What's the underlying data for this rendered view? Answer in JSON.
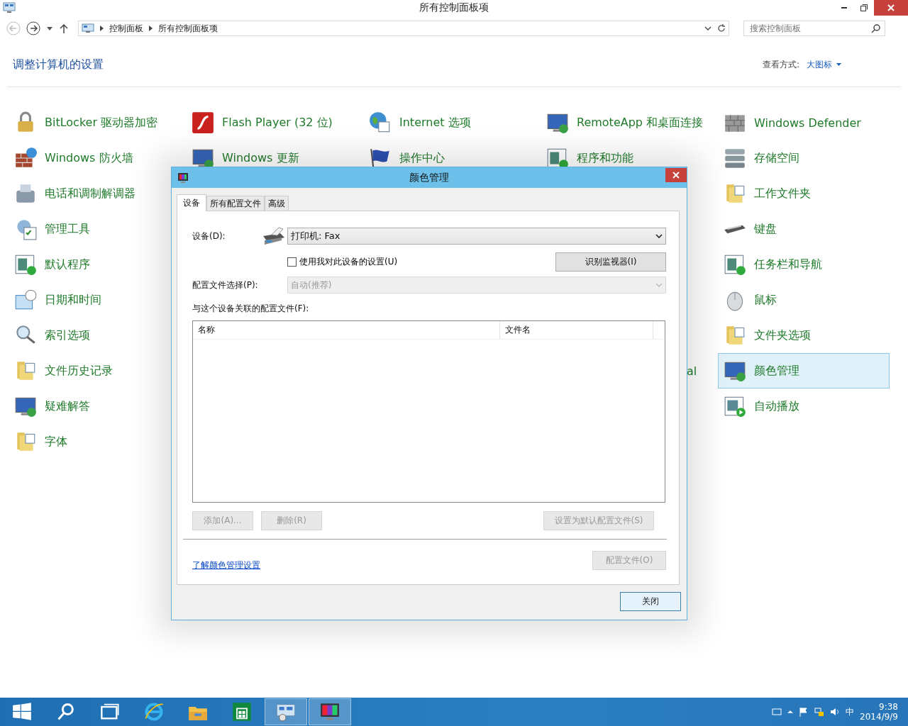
{
  "window": {
    "title": "所有控制面板项"
  },
  "nav": {
    "back_disabled": true,
    "breadcrumb": [
      "控制面板",
      "所有控制面板项"
    ],
    "search": {
      "placeholder": "搜索控制面板"
    }
  },
  "heading": "调整计算机的设置",
  "view": {
    "label": "查看方式:",
    "value": "大图标"
  },
  "columns": [
    {
      "items": [
        {
          "label": "BitLocker 驱动器加密",
          "selected": false
        },
        {
          "label": "Windows 防火墙",
          "selected": false
        },
        {
          "label": "电话和调制解调器",
          "selected": false
        },
        {
          "label": "管理工具",
          "selected": false
        },
        {
          "label": "默认程序",
          "selected": false
        },
        {
          "label": "日期和时间",
          "selected": false
        },
        {
          "label": "索引选项",
          "selected": false
        },
        {
          "label": "文件历史记录",
          "selected": false
        },
        {
          "label": "疑难解答",
          "selected": false
        },
        {
          "label": "字体",
          "selected": false
        }
      ]
    },
    {
      "items": [
        {
          "label": "Flash Player (32 位)",
          "selected": false
        },
        {
          "label": "Windows 更新",
          "selected": false
        }
      ]
    },
    {
      "items": [
        {
          "label": "Internet 选项",
          "selected": false
        },
        {
          "label": "操作中心",
          "selected": false
        }
      ]
    },
    {
      "items": [
        {
          "label": "RemoteApp 和桌面连接",
          "selected": false
        },
        {
          "label": "程序和功能",
          "selected": false
        },
        {
          "label": "al",
          "kind": "fragment"
        }
      ]
    },
    {
      "items": [
        {
          "label": "Windows Defender",
          "selected": false
        },
        {
          "label": "存储空间",
          "selected": false
        },
        {
          "label": "工作文件夹",
          "selected": false
        },
        {
          "label": "键盘",
          "selected": false
        },
        {
          "label": "任务栏和导航",
          "selected": false
        },
        {
          "label": "鼠标",
          "selected": false
        },
        {
          "label": "文件夹选项",
          "selected": false
        },
        {
          "label": "颜色管理",
          "selected": true
        },
        {
          "label": "自动播放",
          "selected": false
        }
      ]
    }
  ],
  "dialog": {
    "title": "颜色管理",
    "tabs": [
      {
        "label": "设备",
        "selected": true
      },
      {
        "label": "所有配置文件",
        "selected": false
      },
      {
        "label": "高级",
        "selected": false
      }
    ],
    "device_label": "设备(D):",
    "device": {
      "value": "打印机: Fax",
      "disabled": false
    },
    "use_my_settings": {
      "label": "使用我对此设备的设置(U)",
      "checked": false
    },
    "identify_button": {
      "label": "识别监视器(I)",
      "disabled": false
    },
    "profile_label": "配置文件选择(P):",
    "profile": {
      "value": "自动(推荐)",
      "disabled": true
    },
    "associated_label": "与这个设备关联的配置文件(F):",
    "list_columns": [
      "名称",
      "文件名"
    ],
    "add_button": {
      "label": "添加(A)...",
      "disabled": true
    },
    "remove_button": {
      "label": "删除(R)",
      "disabled": true
    },
    "default_button": {
      "label": "设置为默认配置文件(S)",
      "disabled": true
    },
    "link": "了解颜色管理设置",
    "profiles_button": {
      "label": "配置文件(O)",
      "disabled": true
    },
    "close_button": {
      "label": "关闭",
      "disabled": false
    }
  },
  "taskbar": {
    "apps": [
      {
        "kind": "start",
        "selected": false
      },
      {
        "kind": "search",
        "selected": false
      },
      {
        "kind": "taskview",
        "selected": false
      },
      {
        "kind": "browser",
        "selected": false
      },
      {
        "kind": "explorer",
        "selected": false
      },
      {
        "kind": "store",
        "selected": false
      },
      {
        "kind": "control",
        "selected": true
      },
      {
        "kind": "color",
        "selected": true
      }
    ],
    "ime": "中",
    "time": "9:38",
    "date": "2014/9/9"
  }
}
